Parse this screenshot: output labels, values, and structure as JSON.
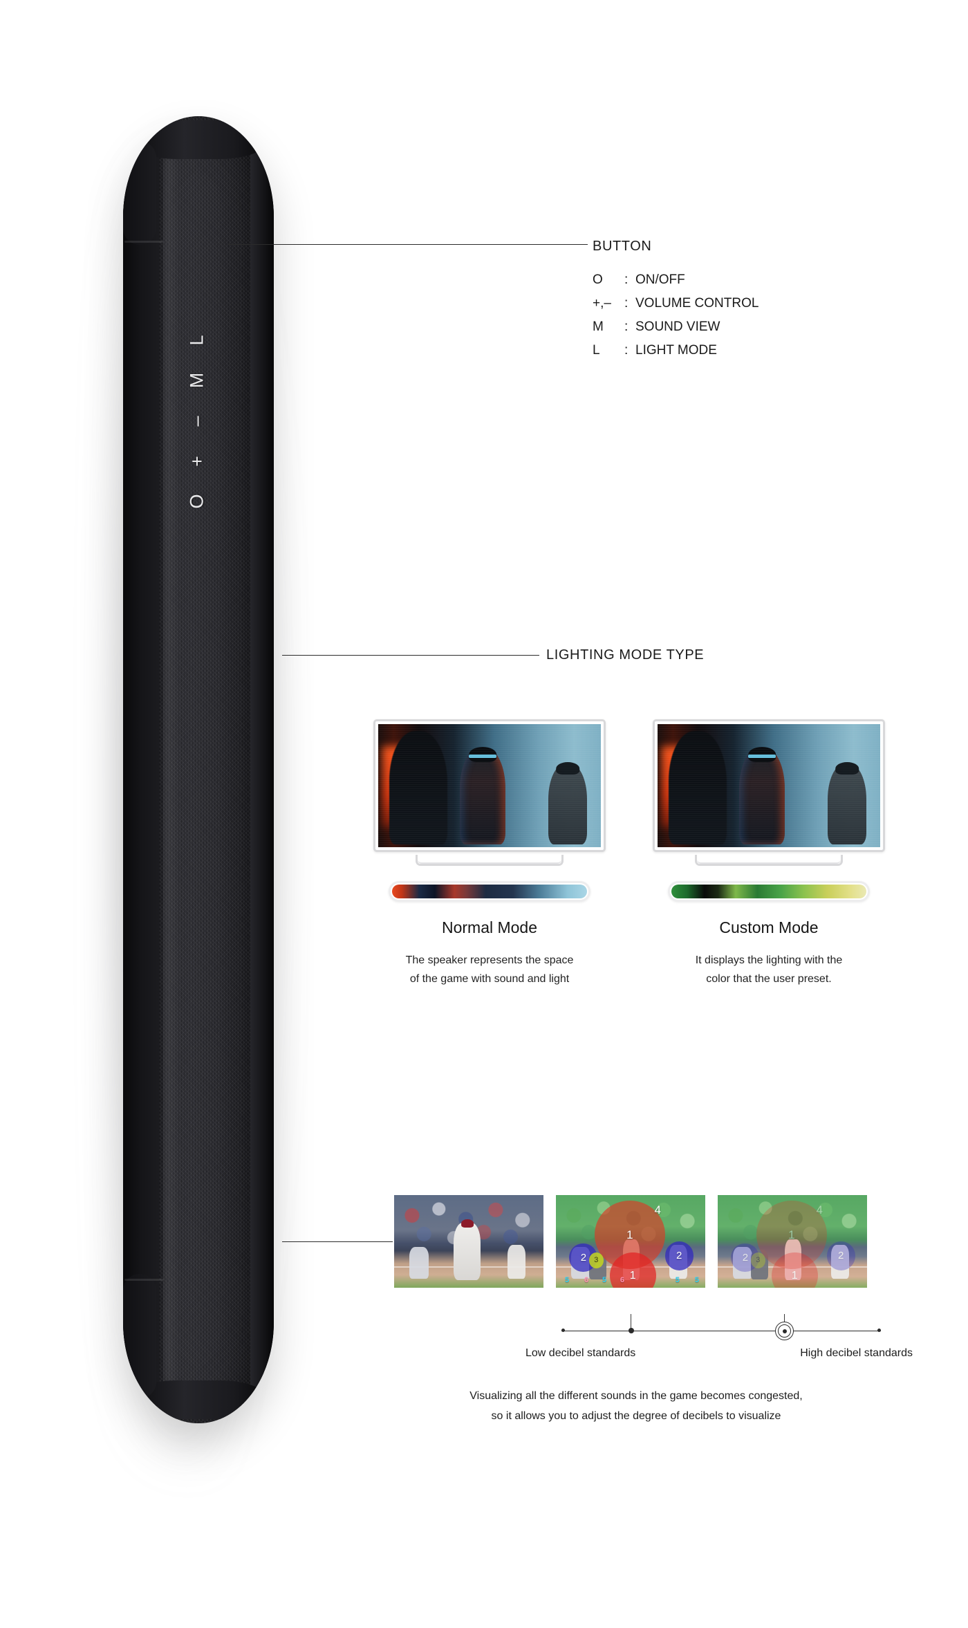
{
  "device": {
    "name": "portable-speaker",
    "button_glyphs": [
      "L",
      "M",
      "–",
      "+",
      "O"
    ]
  },
  "callouts": {
    "button": {
      "title": "BUTTON",
      "rows": [
        {
          "key": "O",
          "sep": ":",
          "value": "ON/OFF"
        },
        {
          "key": "+,–",
          "sep": ":",
          "value": "VOLUME CONTROL"
        },
        {
          "key": "M",
          "sep": ":",
          "value": "SOUND VIEW"
        },
        {
          "key": "L",
          "sep": ":",
          "value": "LIGHT MODE"
        }
      ]
    },
    "lighting": {
      "title": "LIGHTING MODE TYPE"
    }
  },
  "lighting_modes": [
    {
      "name": "Normal Mode",
      "desc_line1": "The speaker represents the space",
      "desc_line2": "of the game with sound and light",
      "bar_colors": [
        "#e8491f",
        "#1a2a45",
        "#a8382a",
        "#23354f",
        "#8fc4d8",
        "#a9d6e6"
      ]
    },
    {
      "name": "Custom Mode",
      "desc_line1": "It displays the lighting with the",
      "desc_line2": "color that the user preset.",
      "bar_colors": [
        "#2f8f3c",
        "#0a0b0a",
        "#7fb84a",
        "#49a348",
        "#c9cf5a",
        "#eae9b4"
      ]
    }
  ],
  "decibel": {
    "bubbles_left": [
      {
        "label": "1",
        "role": "main-sound"
      },
      {
        "label": "1",
        "role": "low-sound"
      },
      {
        "label": "2",
        "role": "left-sound"
      },
      {
        "label": "2",
        "role": "right-sound"
      },
      {
        "label": "3",
        "role": "small-sound"
      },
      {
        "label": "4",
        "role": "ambient-sound"
      }
    ],
    "ground_numbers": [
      "5",
      "6",
      "5",
      "6",
      "5",
      "5"
    ],
    "slider": {
      "low_label": "Low decibel standards",
      "high_label": "High decibel standards"
    },
    "caption_line1": "Visualizing all the different sounds in the game becomes congested,",
    "caption_line2": "so it allows you to adjust the degree of decibels to visualize"
  },
  "colors": {
    "accent_red": "#d63e28",
    "accent_blue": "#3028be",
    "accent_yellow": "#c4d61e",
    "line": "#2b2b2b",
    "text": "#1d1d1d"
  }
}
